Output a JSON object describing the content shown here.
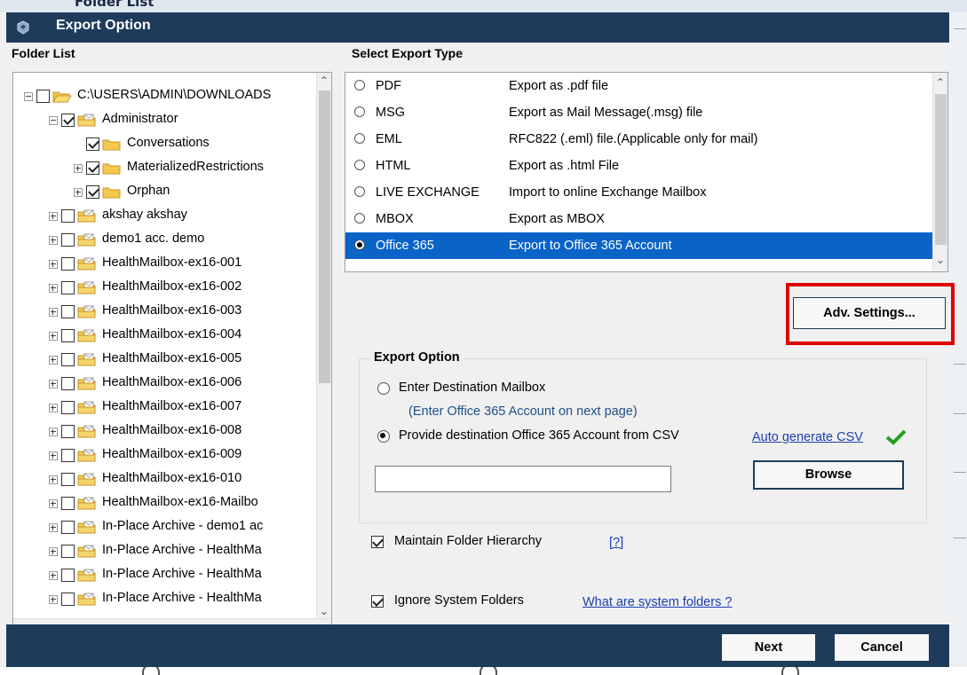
{
  "background": {
    "header_text": "Folder List"
  },
  "dialog": {
    "title": "Export Option",
    "folder_list_label": "Folder List",
    "select_export_type_label": "Select Export Type"
  },
  "tree": {
    "items": [
      {
        "label": "C:\\USERS\\ADMIN\\DOWNLOADS",
        "indent": 0,
        "expander": "minus",
        "checked": false,
        "folder": "open"
      },
      {
        "label": "Administrator",
        "indent": 1,
        "expander": "minus",
        "checked": true,
        "folder": "mail"
      },
      {
        "label": "Conversations",
        "indent": 2,
        "expander": "none",
        "checked": true,
        "folder": "plain"
      },
      {
        "label": "MaterializedRestrictions",
        "indent": 2,
        "expander": "plus",
        "checked": true,
        "folder": "plain"
      },
      {
        "label": "Orphan",
        "indent": 2,
        "expander": "plus",
        "checked": true,
        "folder": "plain"
      },
      {
        "label": "akshay akshay",
        "indent": 1,
        "expander": "plus",
        "checked": false,
        "folder": "mail"
      },
      {
        "label": "demo1 acc. demo",
        "indent": 1,
        "expander": "plus",
        "checked": false,
        "folder": "mail"
      },
      {
        "label": "HealthMailbox-ex16-001",
        "indent": 1,
        "expander": "plus",
        "checked": false,
        "folder": "mail"
      },
      {
        "label": "HealthMailbox-ex16-002",
        "indent": 1,
        "expander": "plus",
        "checked": false,
        "folder": "mail"
      },
      {
        "label": "HealthMailbox-ex16-003",
        "indent": 1,
        "expander": "plus",
        "checked": false,
        "folder": "mail"
      },
      {
        "label": "HealthMailbox-ex16-004",
        "indent": 1,
        "expander": "plus",
        "checked": false,
        "folder": "mail"
      },
      {
        "label": "HealthMailbox-ex16-005",
        "indent": 1,
        "expander": "plus",
        "checked": false,
        "folder": "mail"
      },
      {
        "label": "HealthMailbox-ex16-006",
        "indent": 1,
        "expander": "plus",
        "checked": false,
        "folder": "mail"
      },
      {
        "label": "HealthMailbox-ex16-007",
        "indent": 1,
        "expander": "plus",
        "checked": false,
        "folder": "mail"
      },
      {
        "label": "HealthMailbox-ex16-008",
        "indent": 1,
        "expander": "plus",
        "checked": false,
        "folder": "mail"
      },
      {
        "label": "HealthMailbox-ex16-009",
        "indent": 1,
        "expander": "plus",
        "checked": false,
        "folder": "mail"
      },
      {
        "label": "HealthMailbox-ex16-010",
        "indent": 1,
        "expander": "plus",
        "checked": false,
        "folder": "mail"
      },
      {
        "label": "HealthMailbox-ex16-Mailbo",
        "indent": 1,
        "expander": "plus",
        "checked": false,
        "folder": "mail"
      },
      {
        "label": "In-Place Archive - demo1 ac",
        "indent": 1,
        "expander": "plus",
        "checked": false,
        "folder": "mail"
      },
      {
        "label": "In-Place Archive - HealthMa",
        "indent": 1,
        "expander": "plus",
        "checked": false,
        "folder": "mail"
      },
      {
        "label": "In-Place Archive - HealthMa",
        "indent": 1,
        "expander": "plus",
        "checked": false,
        "folder": "mail"
      },
      {
        "label": "In-Place Archive - HealthMa",
        "indent": 1,
        "expander": "plus",
        "checked": false,
        "folder": "mail"
      }
    ]
  },
  "export_types": [
    {
      "name": "PDF",
      "desc": "Export as .pdf file",
      "selected": false
    },
    {
      "name": "MSG",
      "desc": "Export as Mail Message(.msg) file",
      "selected": false
    },
    {
      "name": "EML",
      "desc": "RFC822 (.eml) file.(Applicable only for mail)",
      "selected": false
    },
    {
      "name": "HTML",
      "desc": "Export as .html File",
      "selected": false
    },
    {
      "name": "LIVE EXCHANGE",
      "desc": "Import to online Exchange Mailbox",
      "selected": false
    },
    {
      "name": "MBOX",
      "desc": "Export as MBOX",
      "selected": false
    },
    {
      "name": "Office 365",
      "desc": "Export to Office 365 Account",
      "selected": true
    }
  ],
  "adv_settings_label": "Adv. Settings...",
  "export_option": {
    "title": "Export Option",
    "opt1_label": "Enter Destination Mailbox",
    "opt1_hint": "(Enter Office 365 Account on next page)",
    "opt2_label": "Provide destination Office 365 Account from CSV",
    "auto_csv_link": "Auto generate CSV",
    "csv_path_value": "",
    "browse_label": "Browse"
  },
  "maintain_hierarchy_label": "Maintain Folder Hierarchy",
  "help_link": "[?]",
  "ignore_system_label": "Ignore System Folders",
  "system_folders_link": "What are system folders ?",
  "footer": {
    "next_label": "Next",
    "cancel_label": "Cancel"
  },
  "colors": {
    "titlebar": "#1e3b5c",
    "selection": "#0a64c8",
    "highlight": "#e00000",
    "check_green": "#22a020"
  }
}
